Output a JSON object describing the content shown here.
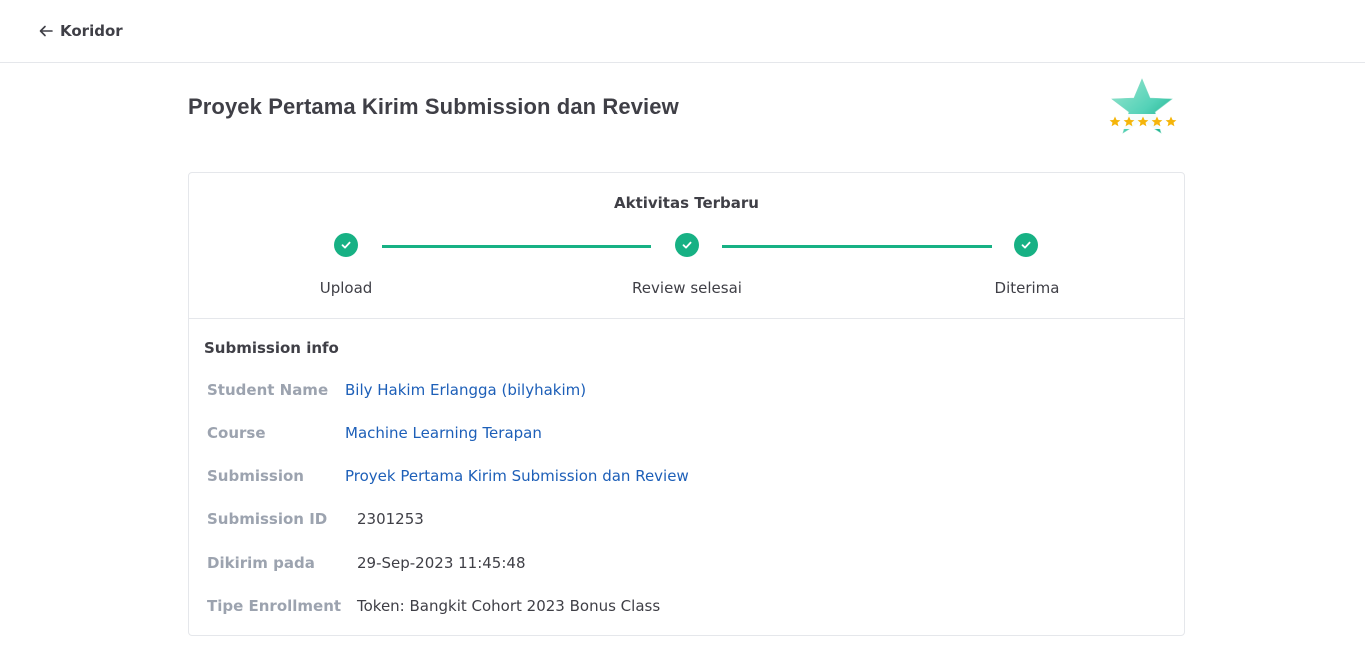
{
  "nav": {
    "back_label": "Koridor"
  },
  "page": {
    "title": "Proyek Pertama Kirim Submission dan Review"
  },
  "activity": {
    "title": "Aktivitas Terbaru",
    "steps": [
      {
        "label": "Upload",
        "status": "done"
      },
      {
        "label": "Review selesai",
        "status": "done"
      },
      {
        "label": "Diterima",
        "status": "done"
      }
    ]
  },
  "submission_info": {
    "title": "Submission info",
    "rows": [
      {
        "label": "Student Name",
        "value": "Bily Hakim Erlangga (bilyhakim)",
        "link": true
      },
      {
        "label": "Course",
        "value": "Machine Learning Terapan",
        "link": true
      },
      {
        "label": "Submission",
        "value": "Proyek Pertama Kirim Submission dan Review",
        "link": true
      },
      {
        "label": "Submission ID",
        "value": "2301253",
        "link": false
      },
      {
        "label": "Dikirim pada",
        "value": "29-Sep-2023 11:45:48",
        "link": false
      },
      {
        "label": "Tipe Enrollment",
        "value": "Token: Bangkit Cohort 2023 Bonus Class",
        "link": false
      }
    ]
  },
  "badge": {
    "icon": "five-star-rating-badge-icon",
    "stars": 5
  },
  "colors": {
    "accent": "#17b184",
    "link": "#1d5fb8",
    "label": "#9ca3af",
    "text": "#3f3f46",
    "border": "#e5e7eb",
    "star": "#f5b50a"
  }
}
